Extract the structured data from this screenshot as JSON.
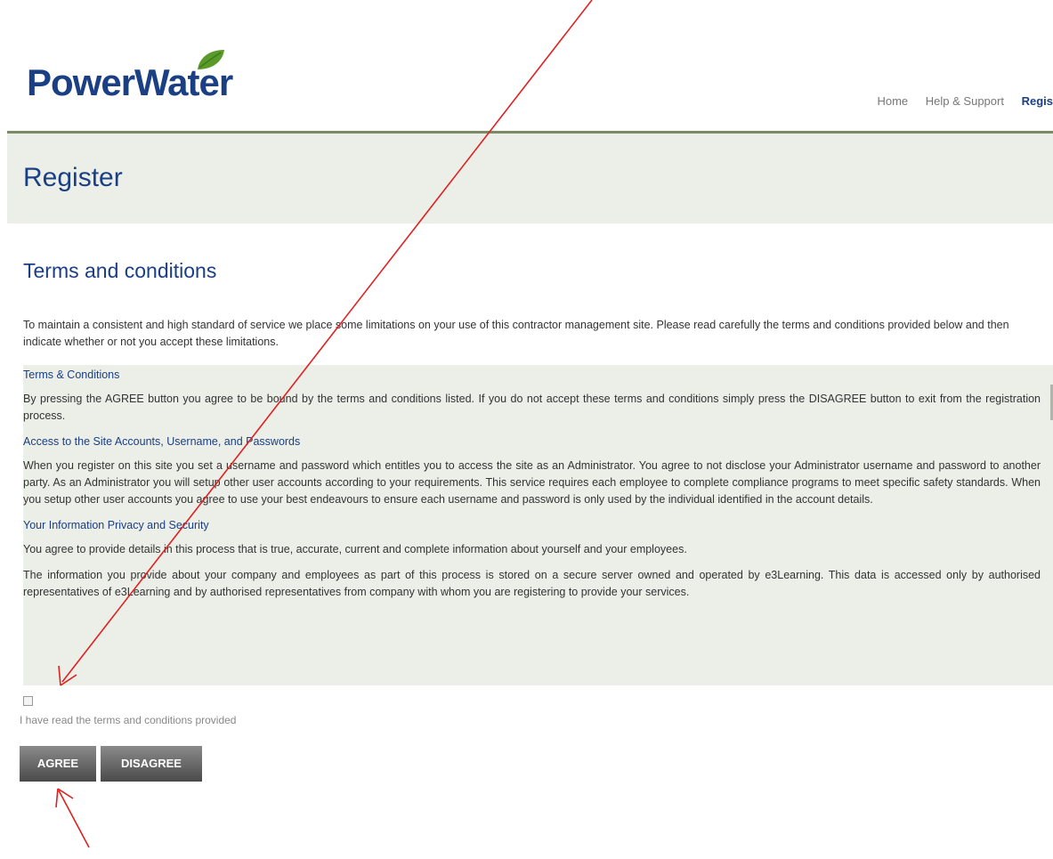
{
  "header": {
    "logo_text": "PowerWater",
    "nav": [
      {
        "label": "Home"
      },
      {
        "label": "Help & Support"
      },
      {
        "label": "Regis"
      }
    ]
  },
  "page_title": "Register",
  "section_title": "Terms and conditions",
  "intro": "To maintain a consistent and high standard of service we place some limitations on your use of this contractor management site. Please read carefully the terms and conditions provided below and then indicate whether or not you accept these limitations.",
  "terms": {
    "heading_1": "Terms & Conditions",
    "para_1": "By pressing the AGREE button you agree to be bound by the terms and conditions listed. If you do not accept these terms and conditions simply press the DISAGREE button to exit from the registration process.",
    "heading_2": "Access to the Site Accounts, Username, and Passwords",
    "para_2": "When you register on this site you set a username and password which entitles you to access the site as an Administrator. You agree to not disclose your Administrator username and password to another party. As an Administrator you will setup other user accounts according to your requirements. This service requires each employee to complete compliance programs to meet specific safety standards. When you setup other user accounts you agree to use your best endeavours to ensure each username and password is only used by the individual identified in the account details.",
    "heading_3": "Your Information Privacy and Security",
    "para_3": "You agree to provide details in this process that is true, accurate, current and complete information about yourself and your employees.",
    "para_4": "The information you provide about your company and employees as part of this process is stored on a secure server owned and operated by e3Learning. This data is accessed only by authorised representatives of e3Learning and by authorised representatives from company with whom you are registering to provide your services."
  },
  "checkbox_label": "I have read the terms and conditions provided",
  "buttons": {
    "agree": "AGREE",
    "disagree": "DISAGREE"
  },
  "colors": {
    "brand_blue": "#1a3f85",
    "leaf_green": "#5a9a2a",
    "annotation_red": "#e02020",
    "panel_bg": "#ecefe8"
  }
}
